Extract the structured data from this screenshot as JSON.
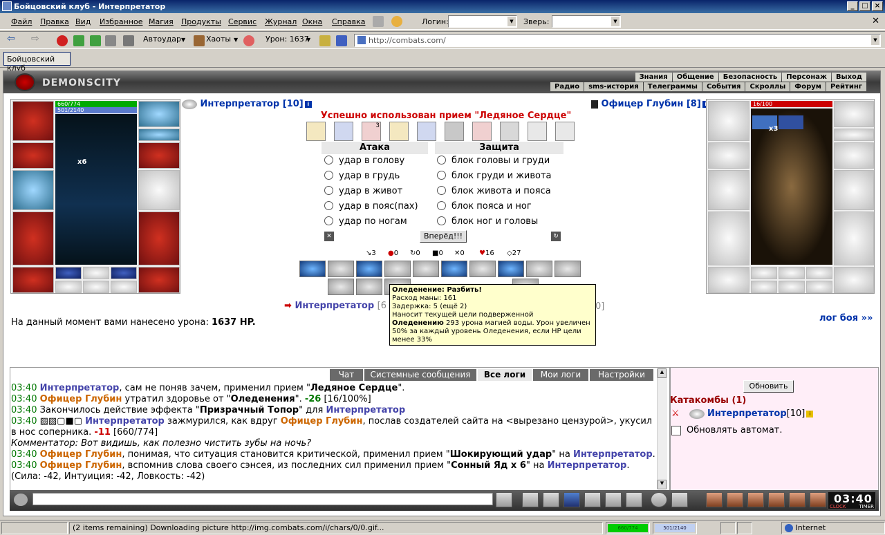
{
  "window": {
    "title": "Бойцовский клуб - Интерпретатор"
  },
  "menu": {
    "items": [
      "Файл",
      "Правка",
      "Вид",
      "Избранное",
      "Магия",
      "Продукты",
      "Сервис",
      "Журнал",
      "Окна",
      "Справка"
    ],
    "login_label": "Логин:",
    "pet_label": "Зверь:"
  },
  "toolbar": {
    "autoudar": "Автоудар",
    "haoty": "Хаоты",
    "uron": "Урон: 1637",
    "url": "http://combats.com/"
  },
  "favorites": {
    "tab": "Бойцовский клуб"
  },
  "site": {
    "logo": "DEMONSCITY",
    "top_nav": [
      "Знания",
      "Общение",
      "Безопасность",
      "Персонаж",
      "Выход"
    ],
    "sub_nav": [
      "Радио",
      "sms-история",
      "Телеграммы",
      "События",
      "Скроллы",
      "Форум",
      "Рейтинг"
    ]
  },
  "player": {
    "name": "Интерпретатор",
    "level": "[10]",
    "hp": "660/774",
    "mana": "501/2140",
    "slot_count": "x6"
  },
  "enemy": {
    "name": "Офицер Глубин",
    "level": "[8]",
    "hp": "16/100",
    "stack_count": "x3"
  },
  "battle": {
    "message": "Успешно использован прием \"Ледяное Сердце\"",
    "icon_badge": "3",
    "attack_header": "Атака",
    "defense_header": "Защита",
    "attacks": [
      "удар в голову",
      "удар в грудь",
      "удар в живот",
      "удар в пояс(пах)",
      "удар по ногам"
    ],
    "blocks": [
      "блок головы и груди",
      "блок груди и живота",
      "блок живота и пояса",
      "блок пояса и ног",
      "блок ног и головы"
    ],
    "go_button": "Вперёд!!!",
    "stats": [
      "3",
      "0",
      "0",
      "0",
      "0",
      "16",
      "27"
    ],
    "damage_text": "На данный момент вами нанесено урона:",
    "damage_value": "1637 HP.",
    "log_link": "лог боя »»",
    "turn_name": "Интерпретатор",
    "turn_rest_left": "[6",
    "turn_rest_right": "0]"
  },
  "tooltip": {
    "title": "Оледенение: Разбить!",
    "lines": [
      "Расход маны: 161",
      "Задержка: 5 (ещё 2)",
      "Наносит текущей цели подверженной"
    ],
    "bold_word": "Оледенению",
    "desc": " 293 урона магией воды. Урон увеличен 50% за каждый уровень Оледенения, если HP цели менее 33%"
  },
  "chat": {
    "tabs": [
      "Чат",
      "Системные сообщения",
      "Все логи",
      "Мои логи",
      "Настройки"
    ],
    "active_tab": "Все логи"
  },
  "side": {
    "refresh_button": "Обновить",
    "location": "Катакомбы (1)",
    "user_name": "Интерпретатор",
    "user_level": "[10]",
    "auto_label": "Обновлять автомат."
  },
  "clock": {
    "time": "03:40",
    "sub_left": "CLOCK",
    "sub_right": "TIMER"
  },
  "statusbar": {
    "status": "(2 items remaining) Downloading picture http://img.combats.com/i/chars/0/0.gif...",
    "hp": "660/774",
    "mana": "501/2140",
    "zone": "Internet"
  },
  "colors": {
    "accent": "#0a246a",
    "hp": "#00aa00",
    "mana": "#5a7acc",
    "enemy_hp": "#cc0000"
  }
}
